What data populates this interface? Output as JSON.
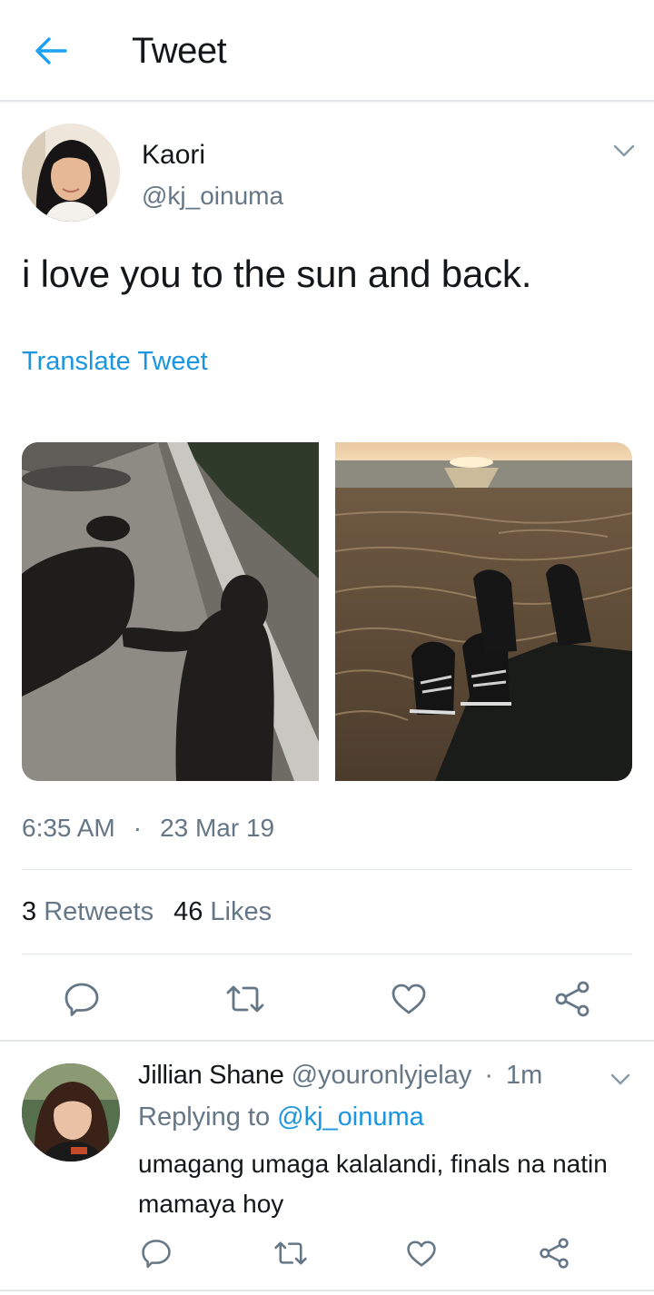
{
  "header": {
    "title": "Tweet"
  },
  "tweet": {
    "author_name": "Kaori",
    "author_handle": "@kj_oinuma",
    "text": "i love you to the sun and back.",
    "translate_label": "Translate Tweet",
    "time": "6:35 AM",
    "separator": "·",
    "date": "23 Mar 19",
    "retweets_count": "3",
    "retweets_label": "Retweets",
    "likes_count": "46",
    "likes_label": "Likes",
    "images": [
      "shadows-holding-hands-photo",
      "beach-sunset-sneakers-photo"
    ]
  },
  "reply": {
    "author_name": "Jillian Shane",
    "author_handle": "@youronlyjelay",
    "separator": "·",
    "time": "1m",
    "replying_prefix": "Replying to",
    "replying_to": "@kj_oinuma",
    "text": "umagang umaga kalalandi, finals na natin mamaya hoy"
  },
  "colors": {
    "accent": "#1b95e0",
    "secondary_text": "#657786",
    "primary_text": "#14171a",
    "divider": "#e1e8ed"
  },
  "icons": [
    "back-arrow-icon",
    "chevron-down-icon",
    "reply-icon",
    "retweet-icon",
    "like-icon",
    "share-icon"
  ]
}
